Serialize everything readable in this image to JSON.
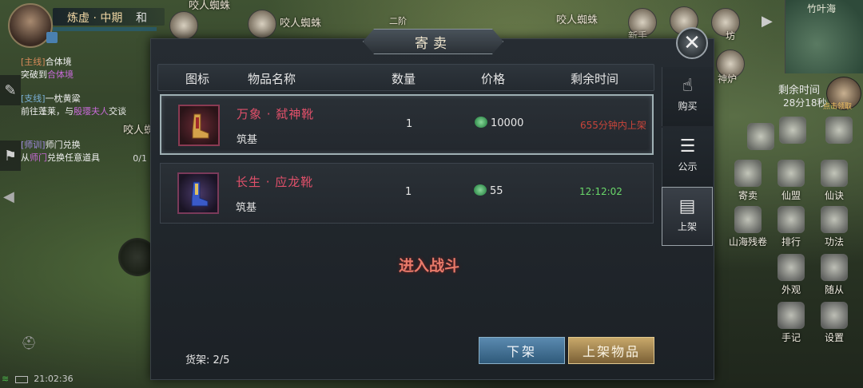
{
  "hud": {
    "realm": "炼虚 · 中期",
    "name_extra": "和",
    "world_labels": [
      "咬人蜘蛛",
      "咬人蜘蛛",
      "二阶",
      "咬人蜘蛛",
      "咬人蜘蛛"
    ],
    "top_buttons": [
      "新手",
      "坊",
      "神炉"
    ]
  },
  "quests": [
    {
      "tag": "[主线]",
      "title": "合体境",
      "desc_prefix": "突破到",
      "desc_highlight": "合体境",
      "desc_suffix": ""
    },
    {
      "tag": "[支线]",
      "title": "一枕黄粱",
      "desc_prefix": "前往蓬莱，与",
      "desc_highlight": "殷璎夫人",
      "desc_suffix": "交谈"
    },
    {
      "tag": "[师训]",
      "title": "师门兑换",
      "desc_prefix": "从",
      "desc_highlight": "师门",
      "desc_suffix": "兑换任意道具",
      "count": "0/1"
    }
  ],
  "minimap": {
    "title": "竹叶海"
  },
  "remaining": {
    "label": "剩余时间",
    "value": "28分18秒",
    "icon_caption": "点击领取"
  },
  "right_buttons": [
    {
      "label": "寄卖",
      "icon": "consign-icon"
    },
    {
      "label": "仙盟",
      "icon": "alliance-icon"
    },
    {
      "label": "仙诀",
      "icon": "scroll-icon"
    },
    {
      "label": "山海残卷",
      "icon": "map-scroll-icon"
    },
    {
      "label": "排行",
      "icon": "rank-icon"
    },
    {
      "label": "功法",
      "icon": "skill-icon"
    },
    {
      "label": "外观",
      "icon": "appearance-icon"
    },
    {
      "label": "随从",
      "icon": "follower-icon"
    },
    {
      "label": "手记",
      "icon": "notebook-icon"
    },
    {
      "label": "设置",
      "icon": "gear-icon"
    }
  ],
  "status": {
    "time": "21:02:36"
  },
  "modal": {
    "title": "寄卖",
    "columns": [
      "图标",
      "物品名称",
      "数量",
      "价格",
      "剩余时间"
    ],
    "items": [
      {
        "name": "万象 · 弑神靴",
        "sub": "筑基",
        "qty": "1",
        "price": "10000",
        "time": "655分钟内上架",
        "time_color": "#c8443a",
        "icon": "red-boots-icon"
      },
      {
        "name": "长生 · 应龙靴",
        "sub": "筑基",
        "qty": "1",
        "price": "55",
        "time": "12:12:02",
        "time_color": "#6ad86a",
        "icon": "blue-boots-icon"
      }
    ],
    "battle_notice": "进入战斗",
    "shelf_label": "货架: 2/5",
    "delist_label": "下架",
    "list_label": "上架物品",
    "tabs": [
      {
        "label": "购买",
        "icon": "buy-icon"
      },
      {
        "label": "公示",
        "icon": "notice-icon"
      },
      {
        "label": "上架",
        "icon": "list-icon"
      }
    ]
  }
}
